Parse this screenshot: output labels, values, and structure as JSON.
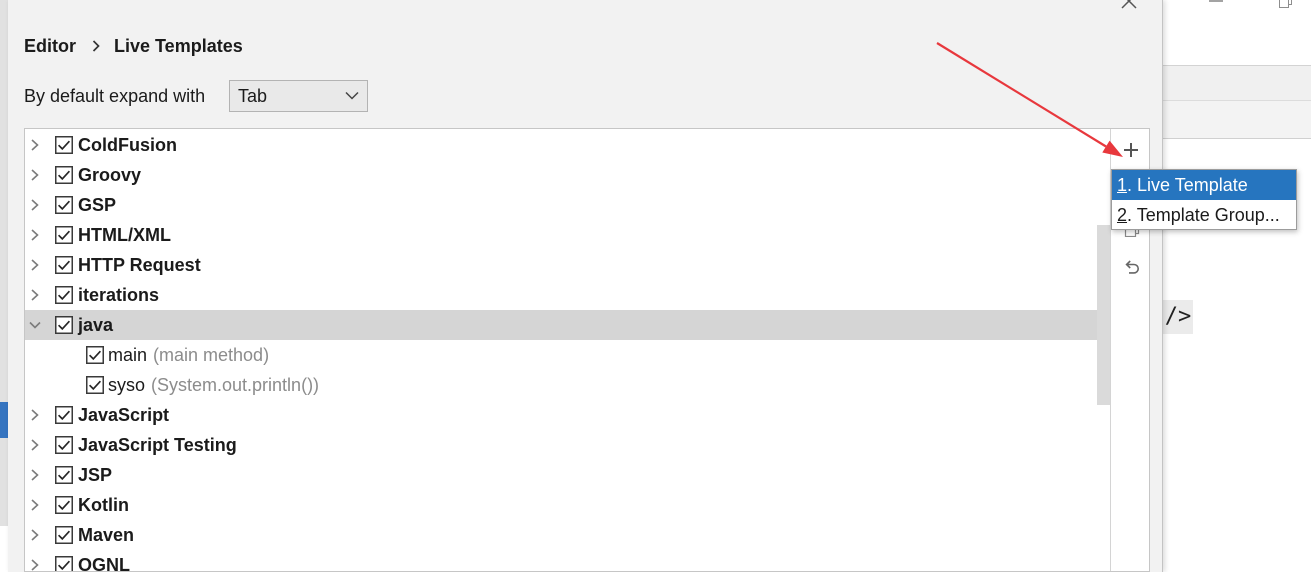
{
  "breadcrumb": {
    "parent": "Editor",
    "separator_icon": "chevron-right-icon",
    "current": "Live Templates"
  },
  "expand_setting": {
    "label": "By default expand with",
    "selected": "Tab",
    "dropdown_icon": "chevron-down-icon"
  },
  "tree": [
    {
      "label": "ColdFusion",
      "checked": true,
      "expanded": false
    },
    {
      "label": "Groovy",
      "checked": true,
      "expanded": false
    },
    {
      "label": "GSP",
      "checked": true,
      "expanded": false
    },
    {
      "label": "HTML/XML",
      "checked": true,
      "expanded": false
    },
    {
      "label": "HTTP Request",
      "checked": true,
      "expanded": false
    },
    {
      "label": "iterations",
      "checked": true,
      "expanded": false
    },
    {
      "label": "java",
      "checked": true,
      "expanded": true,
      "selected": true,
      "children": [
        {
          "abbreviation": "main",
          "description": "(main method)",
          "checked": true
        },
        {
          "abbreviation": "syso",
          "description": "(System.out.println())",
          "checked": true
        }
      ]
    },
    {
      "label": "JavaScript",
      "checked": true,
      "expanded": false
    },
    {
      "label": "JavaScript Testing",
      "checked": true,
      "expanded": false
    },
    {
      "label": "JSP",
      "checked": true,
      "expanded": false
    },
    {
      "label": "Kotlin",
      "checked": true,
      "expanded": false
    },
    {
      "label": "Maven",
      "checked": true,
      "expanded": false
    },
    {
      "label": "OGNL",
      "checked": true,
      "expanded": false
    }
  ],
  "toolbar": {
    "add_icon": "plus-icon",
    "copy_icon": "copy-icon",
    "revert_icon": "undo-icon"
  },
  "add_menu": {
    "items": [
      {
        "mnemonic": "1",
        "text": ". Live Template",
        "highlighted": true
      },
      {
        "mnemonic": "2",
        "text": ". Template Group...",
        "highlighted": false
      }
    ]
  },
  "background_editor": {
    "code_fragment": "/>"
  },
  "window_controls": {
    "close_icon": "close-icon",
    "minimize_icon": "minimize-icon",
    "restore_icon": "restore-icon"
  },
  "colors": {
    "dialog_background": "#f2f2f2",
    "selection_row": "#d5d5d5",
    "menu_highlight": "#2675bf",
    "description_text": "#8c8c8c",
    "annotation_arrow": "#e8383d",
    "sidebar_selection": "#3574c0"
  }
}
